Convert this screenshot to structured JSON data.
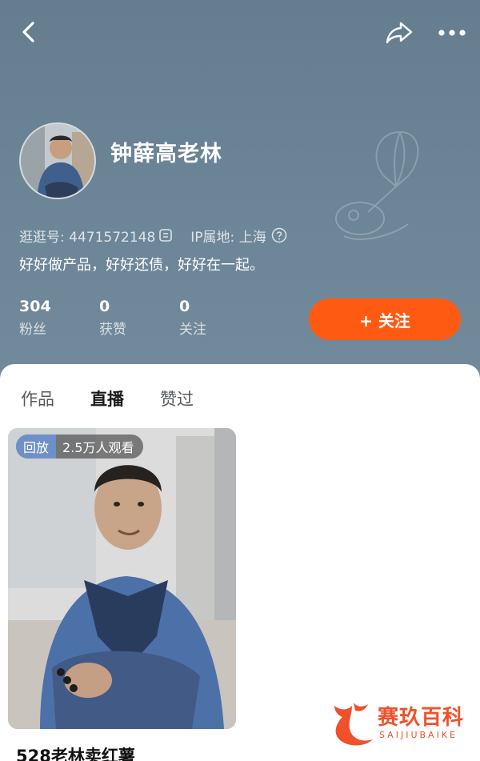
{
  "header": {
    "nickname": "钟薛高老林",
    "account_id": "逛逛号: 4471572148",
    "ip_location": "IP属地: 上海",
    "bio": "好好做产品，好好还债，好好在一起。",
    "follow_label": "+ 关注"
  },
  "stats": [
    {
      "value": "304",
      "label": "粉丝"
    },
    {
      "value": "0",
      "label": "获赞"
    },
    {
      "value": "0",
      "label": "关注"
    }
  ],
  "tabs": [
    {
      "label": "作品",
      "active": false
    },
    {
      "label": "直播",
      "active": true
    },
    {
      "label": "赞过",
      "active": false
    }
  ],
  "card": {
    "tag": "回放",
    "viewers": "2.5万人观看",
    "title": "528老林卖红薯"
  },
  "watermark": {
    "brand": "赛玖百科",
    "brand_en": "SAIJIUBAIKE"
  },
  "colors": {
    "header_bg": "#6c8597",
    "follow_button": "#ff5a12",
    "replay_tag": "#6f8fc8",
    "watermark": "#f0512a"
  },
  "icons": [
    "back-icon",
    "share-icon",
    "more-icon",
    "copy-icon",
    "help-icon"
  ]
}
